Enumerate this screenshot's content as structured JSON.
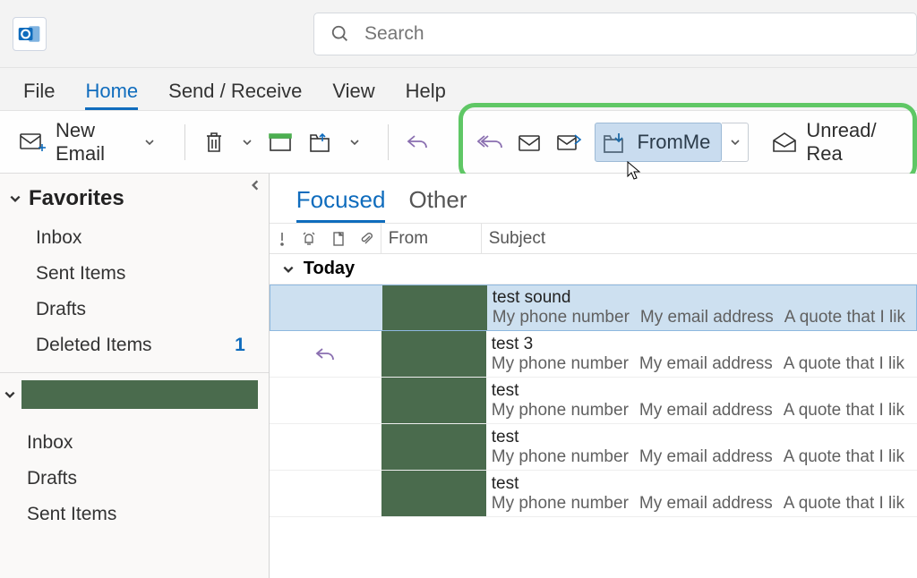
{
  "search": {
    "placeholder": "Search"
  },
  "menu": {
    "file": "File",
    "home": "Home",
    "sendreceive": "Send / Receive",
    "view": "View",
    "help": "Help"
  },
  "ribbon": {
    "new_email": "New Email",
    "quick_step_label": "FromMe",
    "unread": "Unread/ Rea"
  },
  "nav": {
    "favorites_label": "Favorites",
    "favorites": [
      {
        "label": "Inbox"
      },
      {
        "label": "Sent Items"
      },
      {
        "label": "Drafts"
      },
      {
        "label": "Deleted Items",
        "badge": "1"
      }
    ],
    "account_items": [
      {
        "label": "Inbox"
      },
      {
        "label": "Drafts"
      },
      {
        "label": "Sent Items"
      }
    ]
  },
  "main": {
    "tabs": {
      "focused": "Focused",
      "other": "Other"
    },
    "cols": {
      "from": "From",
      "subject": "Subject"
    },
    "group": "Today",
    "preview_phone": "My phone number",
    "preview_email": "My email address",
    "preview_quote": "A quote that I lik",
    "messages": [
      {
        "subject": "test sound",
        "selected": true
      },
      {
        "subject": "test 3",
        "reply": true
      },
      {
        "subject": "test"
      },
      {
        "subject": "test"
      },
      {
        "subject": "test"
      }
    ]
  }
}
